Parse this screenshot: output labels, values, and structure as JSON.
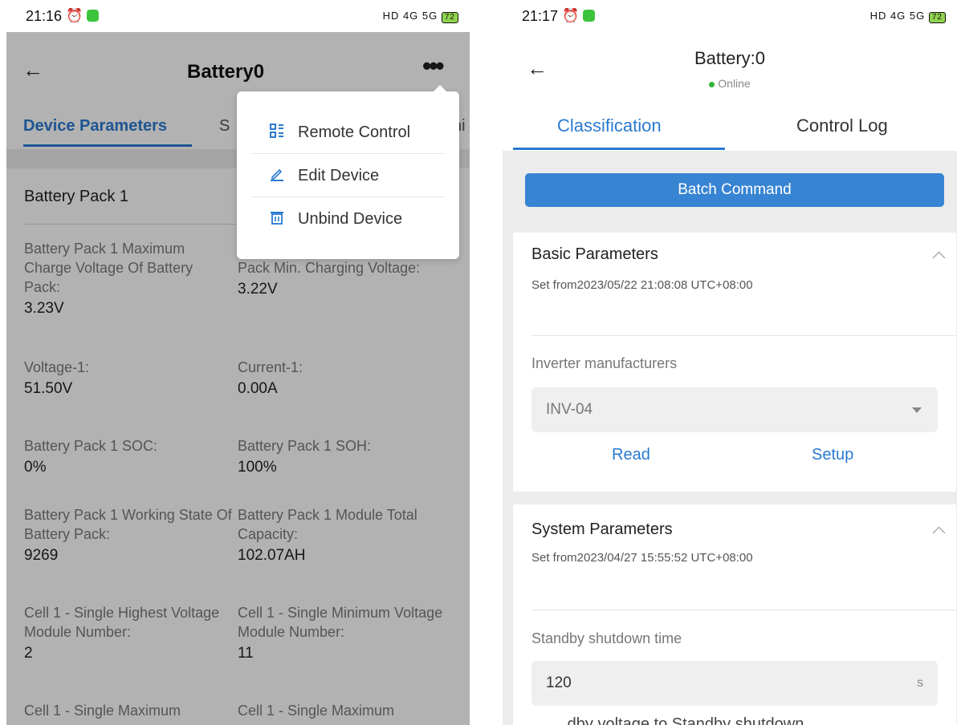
{
  "left": {
    "status": {
      "time": "21:16",
      "sys": "HD 4G 5G",
      "battery": "72"
    },
    "title": "Battery0",
    "tabs": [
      "Device Parameters",
      "S",
      "hi"
    ],
    "section": "Battery Pack 1",
    "params": [
      {
        "label": "Battery Pack 1 Maximum Charge Voltage Of Battery Pack:",
        "value": "3.23V"
      },
      {
        "label": "Pack Min. Charging Voltage:",
        "value": "3.22V"
      },
      {
        "label": "Voltage-1:",
        "value": "51.50V"
      },
      {
        "label": "Current-1:",
        "value": "0.00A"
      },
      {
        "label": "Battery Pack 1 SOC:",
        "value": "0%"
      },
      {
        "label": "Battery Pack 1 SOH:",
        "value": "100%"
      },
      {
        "label": "Battery Pack 1 Working State Of Battery Pack:",
        "value": "9269"
      },
      {
        "label": "Battery Pack 1 Module Total Capacity:",
        "value": "102.07AH"
      },
      {
        "label": "Cell 1 - Single Highest Voltage Module Number:",
        "value": "2"
      },
      {
        "label": "Cell 1 - Single Minimum Voltage Module Number:",
        "value": "11"
      },
      {
        "label": "Cell 1 - Single Maximum",
        "value": ""
      },
      {
        "label": "Cell 1 - Single Maximum",
        "value": ""
      }
    ],
    "menu": [
      {
        "label": "Remote Control",
        "icon": "remote-control-icon"
      },
      {
        "label": "Edit Device",
        "icon": "edit-icon"
      },
      {
        "label": "Unbind Device",
        "icon": "trash-icon"
      }
    ]
  },
  "right": {
    "status": {
      "time": "21:17",
      "sys": "HD 4G 5G",
      "battery": "72"
    },
    "title": "Battery:0",
    "online": "Online",
    "tabs": [
      "Classification",
      "Control Log"
    ],
    "batch": "Batch Command",
    "basic": {
      "title": "Basic Parameters",
      "sub": "Set from2023/05/22 21:08:08 UTC+08:00",
      "field_label": "Inverter manufacturers",
      "field_value": "INV-04",
      "read": "Read",
      "setup": "Setup"
    },
    "system": {
      "title": "System Parameters",
      "sub": "Set from2023/04/27 15:55:52 UTC+08:00",
      "field_label": "Standby shutdown time",
      "field_value": "120",
      "unit": "s"
    },
    "cutoff": "...dby voltage to Standby shutdown..."
  }
}
